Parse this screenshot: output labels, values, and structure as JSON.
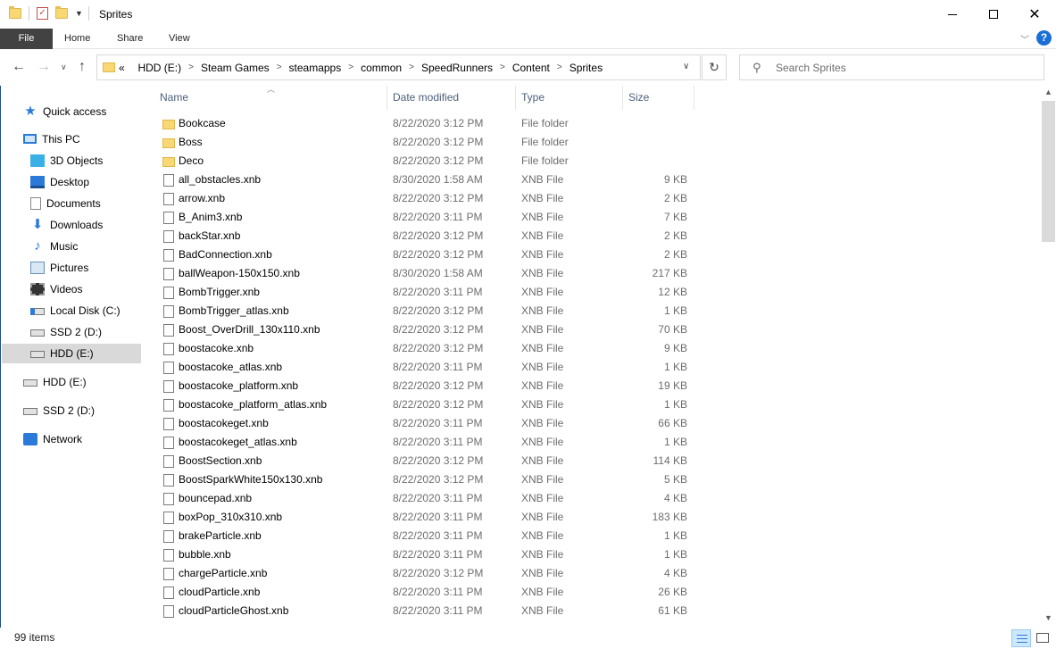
{
  "window": {
    "title": "Sprites",
    "controls": {
      "minimize": "—",
      "maximize": "☐",
      "close": "✕"
    }
  },
  "ribbon": {
    "tabs": [
      "File",
      "Home",
      "Share",
      "View"
    ],
    "help": "?"
  },
  "address": {
    "overflow": "«",
    "crumbs": [
      "HDD (E:)",
      "Steam Games",
      "steamapps",
      "common",
      "SpeedRunners",
      "Content",
      "Sprites"
    ]
  },
  "search": {
    "placeholder": "Search Sprites"
  },
  "nav_pane": {
    "items": [
      {
        "label": "Quick access",
        "icon": "star-icon"
      },
      {
        "label": "This PC",
        "icon": "computer-icon"
      },
      {
        "label": "3D Objects",
        "icon": "3d-objects-icon"
      },
      {
        "label": "Desktop",
        "icon": "desktop-icon"
      },
      {
        "label": "Documents",
        "icon": "documents-icon"
      },
      {
        "label": "Downloads",
        "icon": "downloads-icon"
      },
      {
        "label": "Music",
        "icon": "music-icon"
      },
      {
        "label": "Pictures",
        "icon": "pictures-icon"
      },
      {
        "label": "Videos",
        "icon": "videos-icon"
      },
      {
        "label": "Local Disk (C:)",
        "icon": "os-drive-icon"
      },
      {
        "label": "SSD 2 (D:)",
        "icon": "drive-icon"
      },
      {
        "label": "HDD (E:)",
        "icon": "drive-icon",
        "selected": true
      },
      {
        "label": "HDD (E:)",
        "icon": "drive-icon"
      },
      {
        "label": "SSD 2 (D:)",
        "icon": "drive-icon"
      },
      {
        "label": "Network",
        "icon": "network-icon"
      }
    ]
  },
  "columns": {
    "name": "Name",
    "date": "Date modified",
    "type": "Type",
    "size": "Size"
  },
  "files": [
    {
      "name": "Bookcase",
      "date": "8/22/2020 3:12 PM",
      "type": "File folder",
      "size": "",
      "folder": true
    },
    {
      "name": "Boss",
      "date": "8/22/2020 3:12 PM",
      "type": "File folder",
      "size": "",
      "folder": true
    },
    {
      "name": "Deco",
      "date": "8/22/2020 3:12 PM",
      "type": "File folder",
      "size": "",
      "folder": true
    },
    {
      "name": "all_obstacles.xnb",
      "date": "8/30/2020 1:58 AM",
      "type": "XNB File",
      "size": "9 KB"
    },
    {
      "name": "arrow.xnb",
      "date": "8/22/2020 3:12 PM",
      "type": "XNB File",
      "size": "2 KB"
    },
    {
      "name": "B_Anim3.xnb",
      "date": "8/22/2020 3:11 PM",
      "type": "XNB File",
      "size": "7 KB"
    },
    {
      "name": "backStar.xnb",
      "date": "8/22/2020 3:12 PM",
      "type": "XNB File",
      "size": "2 KB"
    },
    {
      "name": "BadConnection.xnb",
      "date": "8/22/2020 3:12 PM",
      "type": "XNB File",
      "size": "2 KB"
    },
    {
      "name": "ballWeapon-150x150.xnb",
      "date": "8/30/2020 1:58 AM",
      "type": "XNB File",
      "size": "217 KB"
    },
    {
      "name": "BombTrigger.xnb",
      "date": "8/22/2020 3:11 PM",
      "type": "XNB File",
      "size": "12 KB"
    },
    {
      "name": "BombTrigger_atlas.xnb",
      "date": "8/22/2020 3:12 PM",
      "type": "XNB File",
      "size": "1 KB"
    },
    {
      "name": "Boost_OverDrill_130x110.xnb",
      "date": "8/22/2020 3:12 PM",
      "type": "XNB File",
      "size": "70 KB"
    },
    {
      "name": "boostacoke.xnb",
      "date": "8/22/2020 3:12 PM",
      "type": "XNB File",
      "size": "9 KB"
    },
    {
      "name": "boostacoke_atlas.xnb",
      "date": "8/22/2020 3:11 PM",
      "type": "XNB File",
      "size": "1 KB"
    },
    {
      "name": "boostacoke_platform.xnb",
      "date": "8/22/2020 3:12 PM",
      "type": "XNB File",
      "size": "19 KB"
    },
    {
      "name": "boostacoke_platform_atlas.xnb",
      "date": "8/22/2020 3:12 PM",
      "type": "XNB File",
      "size": "1 KB"
    },
    {
      "name": "boostacokeget.xnb",
      "date": "8/22/2020 3:11 PM",
      "type": "XNB File",
      "size": "66 KB"
    },
    {
      "name": "boostacokeget_atlas.xnb",
      "date": "8/22/2020 3:11 PM",
      "type": "XNB File",
      "size": "1 KB"
    },
    {
      "name": "BoostSection.xnb",
      "date": "8/22/2020 3:12 PM",
      "type": "XNB File",
      "size": "114 KB"
    },
    {
      "name": "BoostSparkWhite150x130.xnb",
      "date": "8/22/2020 3:12 PM",
      "type": "XNB File",
      "size": "5 KB"
    },
    {
      "name": "bouncepad.xnb",
      "date": "8/22/2020 3:11 PM",
      "type": "XNB File",
      "size": "4 KB"
    },
    {
      "name": "boxPop_310x310.xnb",
      "date": "8/22/2020 3:11 PM",
      "type": "XNB File",
      "size": "183 KB"
    },
    {
      "name": "brakeParticle.xnb",
      "date": "8/22/2020 3:11 PM",
      "type": "XNB File",
      "size": "1 KB"
    },
    {
      "name": "bubble.xnb",
      "date": "8/22/2020 3:11 PM",
      "type": "XNB File",
      "size": "1 KB"
    },
    {
      "name": "chargeParticle.xnb",
      "date": "8/22/2020 3:12 PM",
      "type": "XNB File",
      "size": "4 KB"
    },
    {
      "name": "cloudParticle.xnb",
      "date": "8/22/2020 3:11 PM",
      "type": "XNB File",
      "size": "26 KB"
    },
    {
      "name": "cloudParticleGhost.xnb",
      "date": "8/22/2020 3:11 PM",
      "type": "XNB File",
      "size": "61 KB"
    }
  ],
  "status": {
    "count": "99 items"
  }
}
